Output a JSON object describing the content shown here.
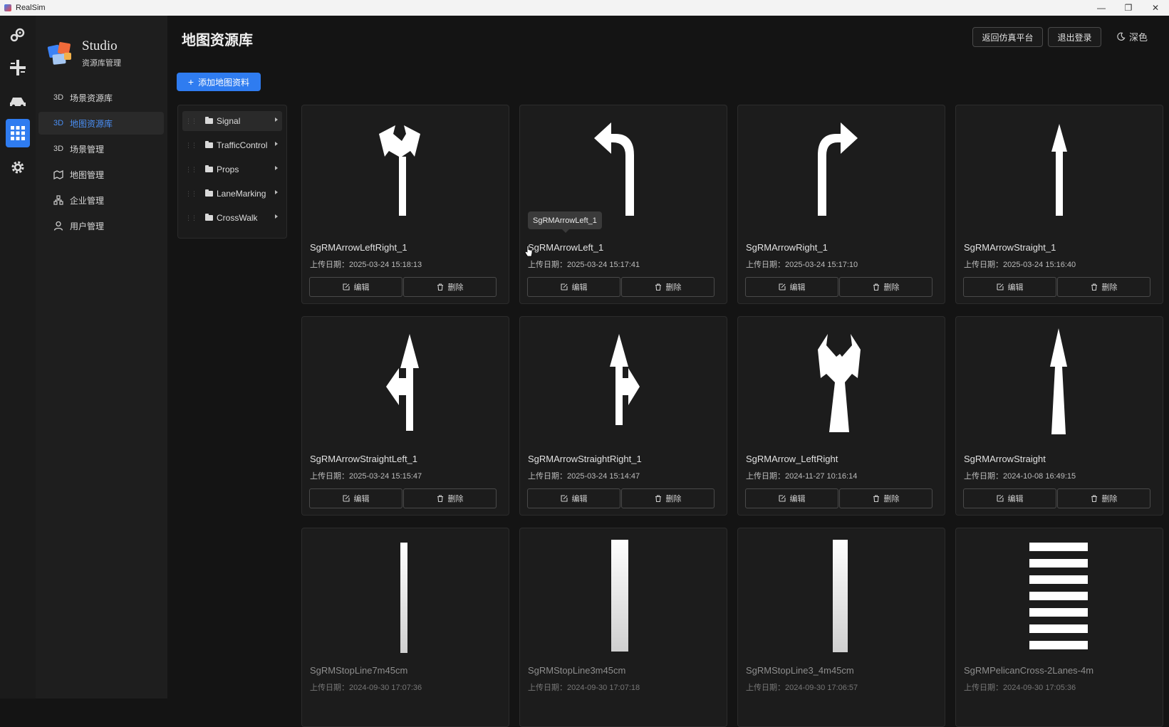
{
  "window": {
    "title": "RealSim",
    "minimize": "—",
    "restore": "❐",
    "close": "✕"
  },
  "rail": {
    "items": [
      "settings-cogs-icon",
      "junction-icon",
      "vehicle-icon",
      "grid-apps-icon",
      "gear-icon"
    ],
    "active_index": 3
  },
  "brand": {
    "name": "Studio",
    "subtitle": "资源库管理"
  },
  "nav": {
    "items": [
      {
        "label": "场景资源库",
        "icon": "3D"
      },
      {
        "label": "地图资源库",
        "icon": "3D"
      },
      {
        "label": "场景管理",
        "icon": "3D"
      },
      {
        "label": "地图管理",
        "icon": "map-icon"
      },
      {
        "label": "企业管理",
        "icon": "org-icon"
      },
      {
        "label": "用户管理",
        "icon": "user-icon"
      }
    ],
    "active_index": 1
  },
  "header": {
    "title": "地图资源库",
    "back_button": "返回仿真平台",
    "logout_button": "退出登录",
    "theme_label": "深色",
    "add_button": "添加地图资料"
  },
  "tree": {
    "items": [
      "Signal",
      "TrafficControl",
      "Props",
      "LaneMarking",
      "CrossWalk"
    ],
    "active_index": 0
  },
  "card_labels": {
    "date_prefix": "上传日期：",
    "edit": "编辑",
    "delete": "删除"
  },
  "cards": [
    {
      "name": "SgRMArrowLeftRight_1",
      "date": "2025-03-24 15:18:13",
      "shape": "left-right-arrow"
    },
    {
      "name": "SgRMArrowLeft_1",
      "date": "2025-03-24 15:17:41",
      "shape": "left-arrow"
    },
    {
      "name": "SgRMArrowRight_1",
      "date": "2025-03-24 15:17:10",
      "shape": "right-arrow"
    },
    {
      "name": "SgRMArrowStraight_1",
      "date": "2025-03-24 15:16:40",
      "shape": "straight-arrow-thin"
    },
    {
      "name": "SgRMArrowStraightLeft_1",
      "date": "2025-03-24 15:15:47",
      "shape": "straight-left-arrow"
    },
    {
      "name": "SgRMArrowStraightRight_1",
      "date": "2025-03-24 15:14:47",
      "shape": "straight-right-arrow"
    },
    {
      "name": "SgRMArrow_LeftRight",
      "date": "2024-11-27 10:16:14",
      "shape": "left-right-arrow-tall"
    },
    {
      "name": "SgRMArrowStraight",
      "date": "2024-10-08 16:49:15",
      "shape": "straight-arrow"
    },
    {
      "name": "SgRMStopLine7m45cm",
      "date": "2024-09-30 17:07:36",
      "shape": "stop-line-thin"
    },
    {
      "name": "SgRMStopLine3m45cm",
      "date": "2024-09-30 17:07:18",
      "shape": "stop-line-wide"
    },
    {
      "name": "SgRMStopLine3_4m45cm",
      "date": "2024-09-30 17:06:57",
      "shape": "stop-line-medium"
    },
    {
      "name": "SgRMPelicanCross-2Lanes-4m",
      "date": "2024-09-30 17:05:36",
      "shape": "crosswalk-stripes"
    }
  ],
  "tooltip": {
    "text": "SgRMArrowLeft_1"
  },
  "colors": {
    "accent": "#2f7cf0",
    "background": "#141414",
    "card": "#1c1c1c"
  }
}
